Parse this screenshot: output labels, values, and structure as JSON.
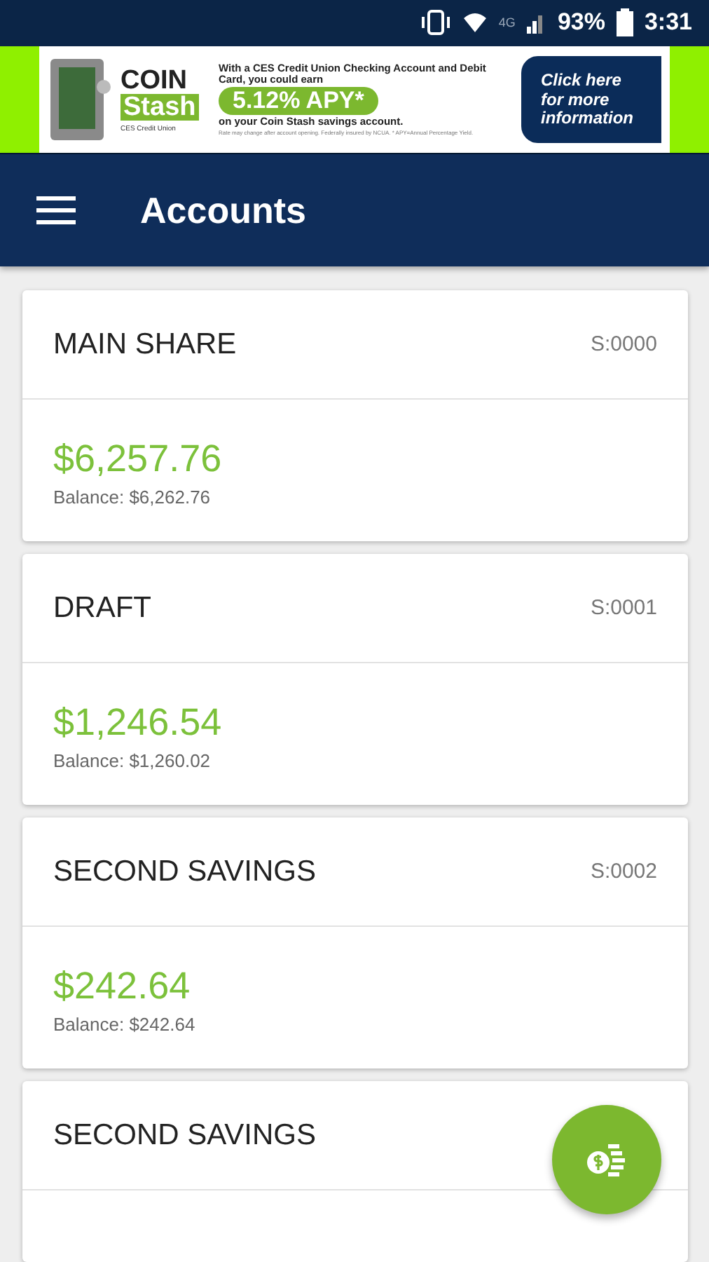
{
  "status_bar": {
    "battery": "93%",
    "time": "3:31",
    "network": "4G"
  },
  "ad": {
    "brand_top": "COIN",
    "brand_bottom": "Stash",
    "brand_org": "CES Credit Union",
    "line_1": "With a CES Credit Union Checking Account and Debit Card, you could earn",
    "rate": "5.12% APY*",
    "line_2": "on your Coin Stash savings account.",
    "fine_print": "Rate may change after account opening. Federally insured by NCUA. * APY=Annual Percentage Yield.",
    "cta": "Click here for more information"
  },
  "app_bar": {
    "title": "Accounts"
  },
  "accounts": [
    {
      "name": "MAIN SHARE",
      "id": "S:0000",
      "available": "$6,257.76",
      "balance": "Balance: $6,262.76"
    },
    {
      "name": "DRAFT",
      "id": "S:0001",
      "available": "$1,246.54",
      "balance": "Balance: $1,260.02"
    },
    {
      "name": "SECOND SAVINGS",
      "id": "S:0002",
      "available": "$242.64",
      "balance": "Balance: $242.64"
    },
    {
      "name": "SECOND SAVINGS"
    }
  ]
}
